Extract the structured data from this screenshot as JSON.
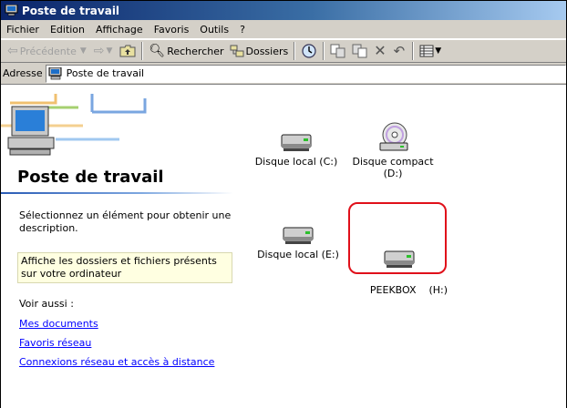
{
  "window": {
    "title": "Poste de travail"
  },
  "menu": [
    "Fichier",
    "Edition",
    "Affichage",
    "Favoris",
    "Outils",
    "?"
  ],
  "toolbar": {
    "back_label": "Précédente",
    "search_label": "Rechercher",
    "folders_label": "Dossiers"
  },
  "address": {
    "label": "Adresse",
    "value": "Poste de travail"
  },
  "left": {
    "title": "Poste de travail",
    "description": "Sélectionnez un élément pour obtenir une description.",
    "info": "Affiche les dossiers et fichiers présents sur votre ordinateur",
    "see_also": "Voir aussi :",
    "links": [
      "Mes documents",
      "Favoris réseau",
      "Connexions réseau et accès à distance"
    ]
  },
  "drives": [
    {
      "label": "Disque local (C:)",
      "icon": "hard-drive-icon"
    },
    {
      "label": "Disque compact (D:)",
      "icon": "cd-drive-icon"
    },
    {
      "label": "Disque local (E:)",
      "icon": "hard-drive-icon"
    },
    {
      "label": "PEEKBOX    (H:)",
      "icon": "hard-drive-icon",
      "highlighted": true
    }
  ],
  "colors": {
    "titlebar_start": "#0a246a",
    "titlebar_end": "#a6caf0",
    "chrome": "#d4d0c8",
    "link": "#0000ff",
    "highlight_ring": "#e0101a",
    "info_box": "#ffffe1"
  }
}
